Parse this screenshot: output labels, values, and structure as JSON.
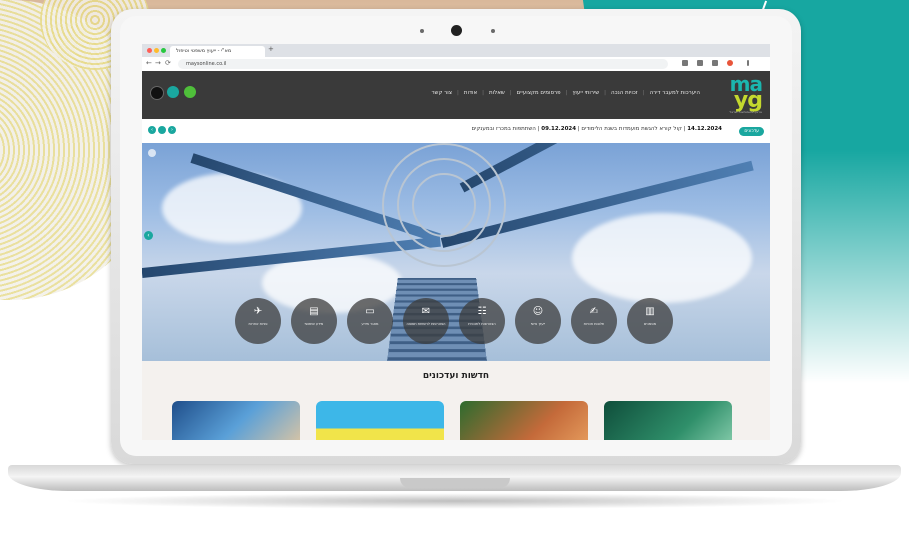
{
  "browser": {
    "tab_title": "מא\"י - ייעוץ משפטי וטיפול",
    "new_tab": "+",
    "url": "maysonline.co.il",
    "nav_back": "←",
    "nav_forward": "→",
    "nav_reload": "⟳"
  },
  "site": {
    "logo_top": "ma",
    "logo_bottom": "yg",
    "logo_tagline": "ארגון המשכנתאות ישראל",
    "nav": [
      "היערכות למעבר דירה",
      "זכויות הנכה",
      "שירותי ייעוץ",
      "פרסומים מקצועיים",
      "שאלות",
      "אודות",
      "צור קשר"
    ]
  },
  "ticker": {
    "badge": "עדכונים",
    "date1": "14.12.2024",
    "item1": "קול קורא להגשת מועמדות בשנת הלימודים",
    "date2": "09.12.2024",
    "item2": "השתתפות במכרז ובמענקים",
    "prev": "‹",
    "next": "›"
  },
  "hero": {
    "arrow": "‹",
    "quick_links": [
      {
        "icon": "✈",
        "label": "פניות אחרות"
      },
      {
        "icon": "▤",
        "label": "מידע שימושי"
      },
      {
        "icon": "▭",
        "label": "מאגר מידע"
      },
      {
        "icon": "✉",
        "label": "הצטרפות לרשימת תפוצה"
      },
      {
        "icon": "☷",
        "label": "הצטרפות לתוכנית"
      },
      {
        "icon": "☺",
        "label": "ייעוץ אישי"
      },
      {
        "icon": "✍",
        "label": "תלונות וזכויות"
      },
      {
        "icon": "▥",
        "label": "מסמכים"
      }
    ]
  },
  "news": {
    "title": "חדשות ועדכונים"
  }
}
